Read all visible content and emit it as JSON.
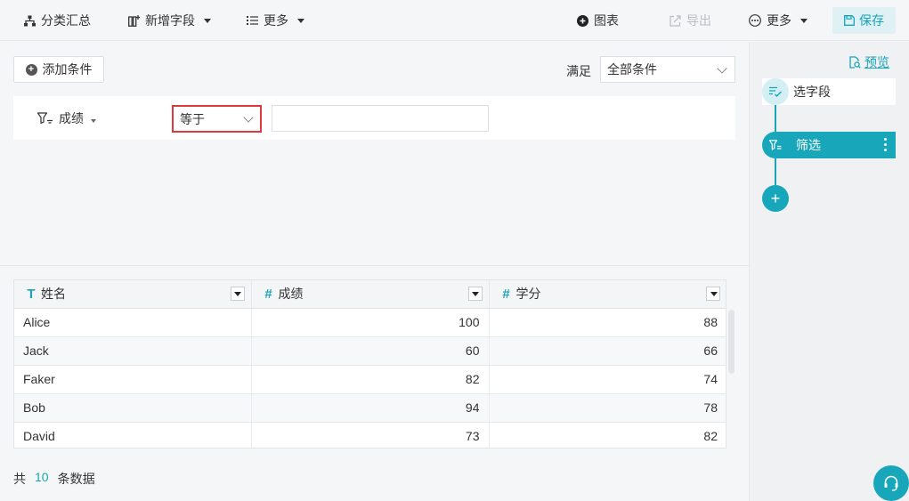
{
  "toolbar": {
    "group_summary": "分类汇总",
    "add_field": "新增字段",
    "more_left": "更多",
    "chart": "图表",
    "export": "导出",
    "more_right": "更多",
    "save": "保存"
  },
  "filter": {
    "add_condition": "添加条件",
    "satisfy_label": "满足",
    "satisfy_value": "全部条件",
    "condition": {
      "field": "成绩",
      "operator": "等于",
      "value": ""
    }
  },
  "table": {
    "columns": [
      {
        "icon": "T",
        "label": "姓名",
        "type": "text"
      },
      {
        "icon": "#",
        "label": "成绩",
        "type": "number"
      },
      {
        "icon": "#",
        "label": "学分",
        "type": "number"
      }
    ],
    "rows": [
      [
        "Alice",
        "100",
        "88"
      ],
      [
        "Jack",
        "60",
        "66"
      ],
      [
        "Faker",
        "82",
        "74"
      ],
      [
        "Bob",
        "94",
        "78"
      ],
      [
        "David",
        "73",
        "82"
      ]
    ]
  },
  "footer": {
    "prefix": "共",
    "count": "10",
    "suffix": "条数据"
  },
  "right_panel": {
    "preview": "预览",
    "steps": [
      {
        "label": "选字段",
        "icon": "select-fields-icon"
      },
      {
        "label": "筛选",
        "icon": "filter-icon",
        "active": true
      }
    ]
  },
  "colors": {
    "accent": "#17a6ba",
    "highlight_border": "#e0373d"
  }
}
